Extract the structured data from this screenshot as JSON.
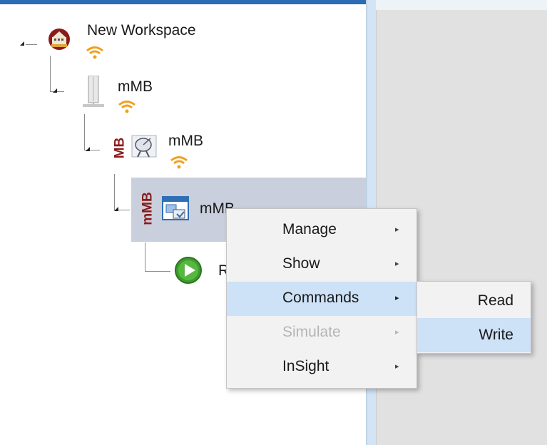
{
  "tree": {
    "workspace": {
      "label": "New Workspace",
      "icon": "workspace-globe-icon"
    },
    "device": {
      "label": "mMB",
      "icon": "device-tower-icon"
    },
    "driver": {
      "label": "mMB",
      "badge": "MB",
      "icon": "satellite-dish-icon"
    },
    "endpoint": {
      "label": "mMB",
      "badge": "mMB",
      "icon": "window-app-icon"
    },
    "child": {
      "label": "R",
      "icon": "play-circle-icon"
    }
  },
  "context_menu": {
    "items": [
      {
        "label": "Manage",
        "arrow": "▸",
        "state": "normal"
      },
      {
        "label": "Show",
        "arrow": "▸",
        "state": "normal"
      },
      {
        "label": "Commands",
        "arrow": "▸",
        "state": "highlighted"
      },
      {
        "label": "Simulate",
        "arrow": "▸",
        "state": "disabled"
      },
      {
        "label": "InSight",
        "arrow": "▸",
        "state": "normal"
      }
    ]
  },
  "submenu": {
    "items": [
      {
        "label": "Read",
        "state": "normal"
      },
      {
        "label": "Write",
        "state": "highlighted"
      }
    ]
  },
  "colors": {
    "selection": "#c9cfdc",
    "menu_highlight": "#cde1f7",
    "badge": "#8b1a1a",
    "wifi": "#f0a020",
    "accent": "#2b6cb3"
  }
}
